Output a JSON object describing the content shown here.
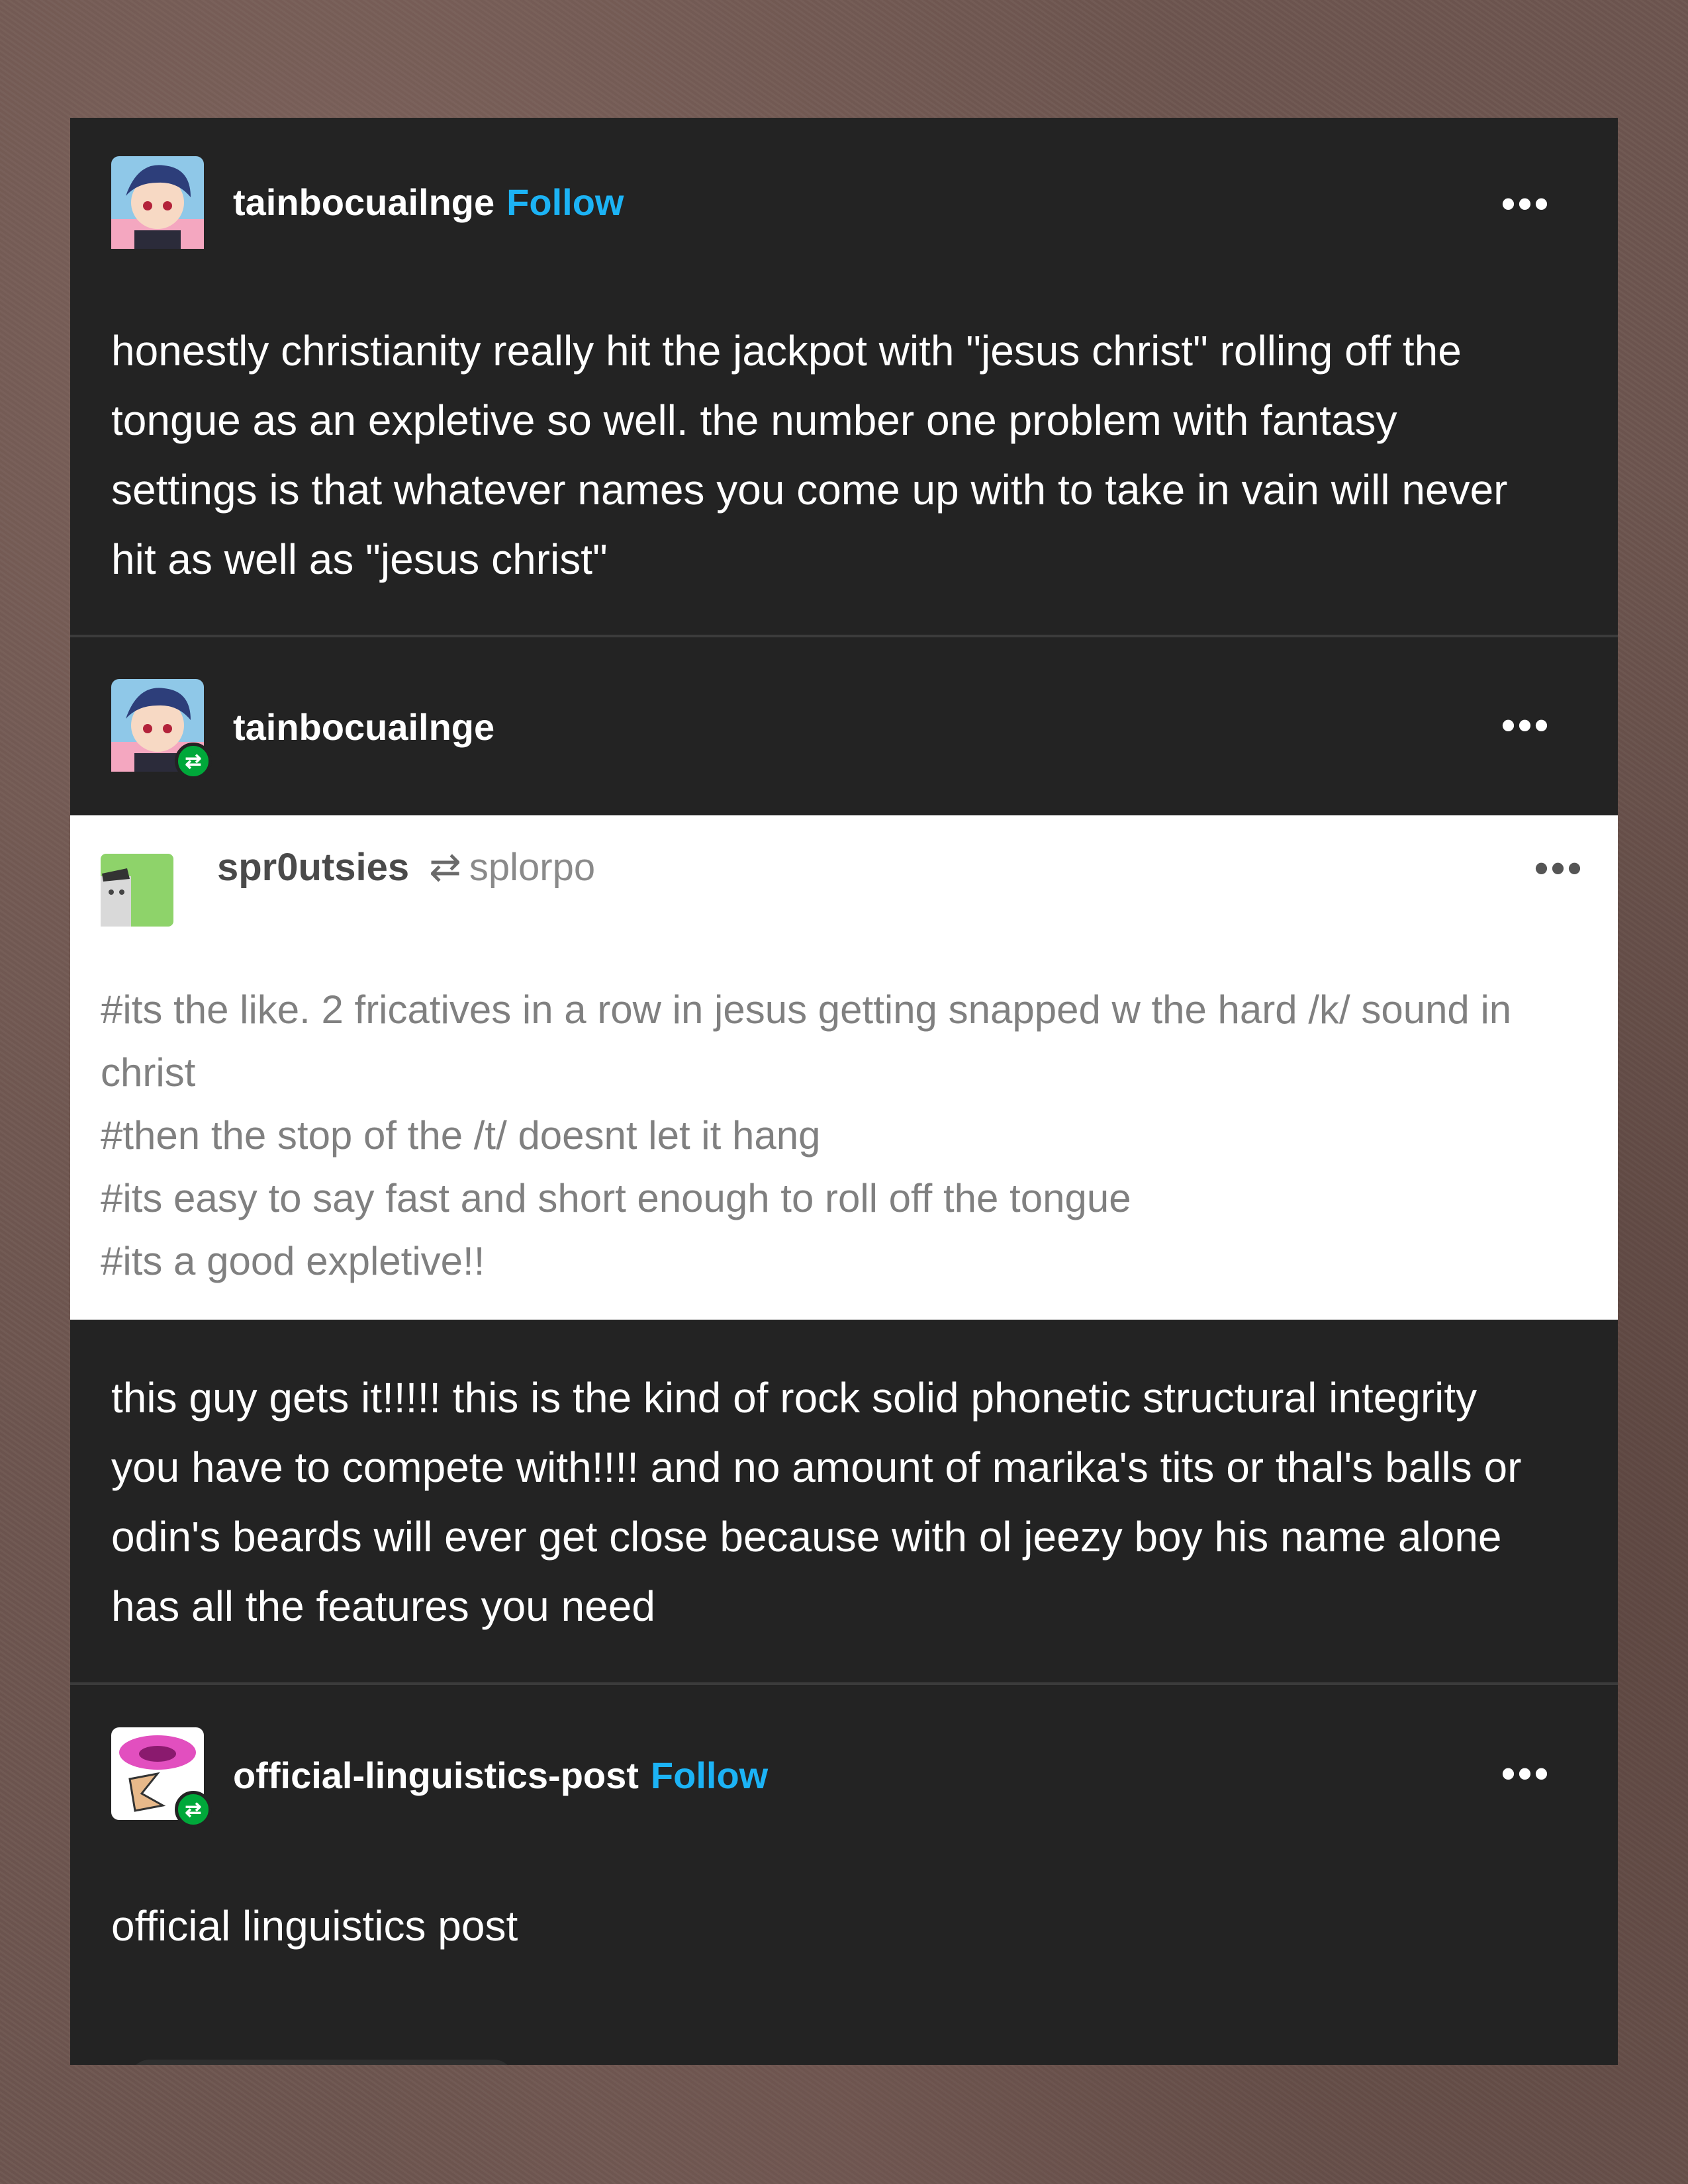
{
  "post": {
    "op": {
      "username": "tainbocuailnge",
      "follow": "Follow",
      "body": "honestly christianity really hit the jackpot with \"jesus christ\" rolling off the tongue as an expletive so well. the number one problem with fantasy settings is that whatever names you come up with to take in vain will never hit as well as \"jesus christ\"",
      "more": "•••"
    },
    "reblog1": {
      "username": "tainbocuailnge",
      "more": "•••",
      "badge_icon": "reblog-icon"
    },
    "quoted": {
      "username": "spr0utsies",
      "reblog_symbol": "⇄",
      "via": "splorpo",
      "more": "•••",
      "tags": [
        "#its the like. 2 fricatives in a row in jesus getting snapped w the hard /k/ sound in christ",
        "#then the stop of the /t/ doesnt let it hang",
        "#its easy to say fast and short enough to roll off the tongue",
        "#its a good expletive!!"
      ]
    },
    "reblog1_body": "this guy gets it!!!!! this is the kind of rock solid phonetic structural integrity you have to compete with!!!! and no amount of marika's tits or thal's balls or odin's beards will ever get close because with ol jeezy boy his name alone has all the features you need",
    "reblog2": {
      "username": "official-linguistics-post",
      "follow": "Follow",
      "more": "•••",
      "body": "official linguistics post"
    }
  },
  "colors": {
    "card_bg": "#232323",
    "follow": "#1cb3f5",
    "reblog_badge": "#00a83a",
    "tag_text": "#808080"
  }
}
